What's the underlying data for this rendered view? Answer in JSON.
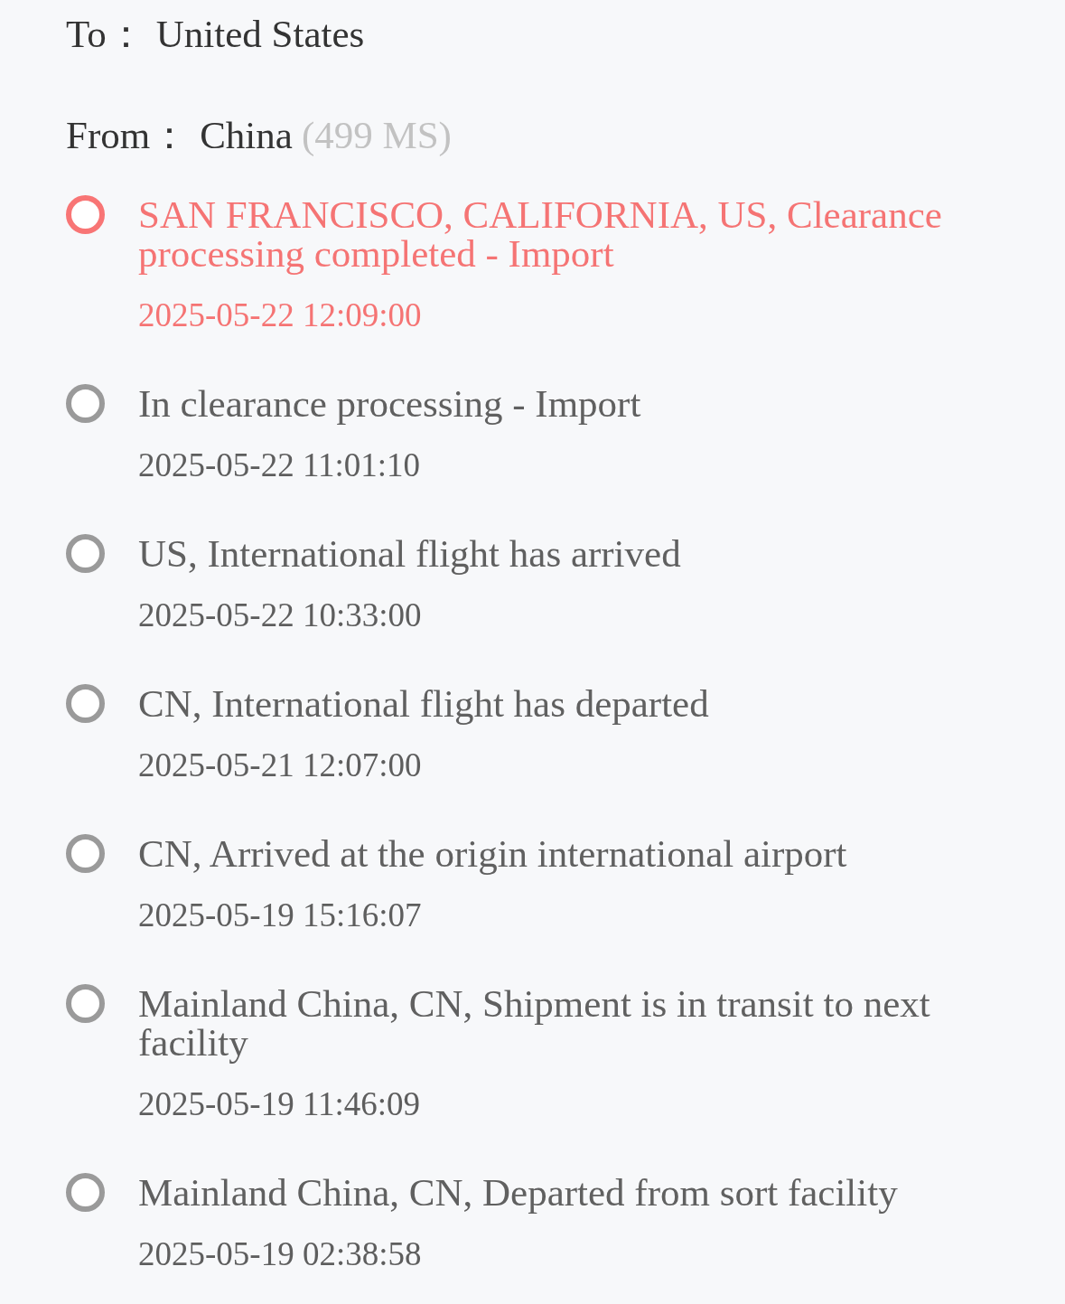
{
  "destination": {
    "label": "To：",
    "value": "United States"
  },
  "origin": {
    "label": "From：",
    "value": "China",
    "note": "(499 MS)"
  },
  "events": [
    {
      "description": "SAN FRANCISCO, CALIFORNIA, US, Clearance processing completed - Import",
      "time": "2025-05-22 12:09:00",
      "current": true
    },
    {
      "description": "In clearance processing - Import",
      "time": "2025-05-22 11:01:10",
      "current": false
    },
    {
      "description": "US, International flight has arrived",
      "time": "2025-05-22 10:33:00",
      "current": false
    },
    {
      "description": "CN, International flight has departed",
      "time": "2025-05-21 12:07:00",
      "current": false
    },
    {
      "description": "CN, Arrived at the origin international airport",
      "time": "2025-05-19 15:16:07",
      "current": false
    },
    {
      "description": "Mainland China, CN, Shipment is in transit to next facility",
      "time": "2025-05-19 11:46:09",
      "current": false
    },
    {
      "description": "Mainland China, CN, Departed from sort facility",
      "time": "2025-05-19 02:38:58",
      "current": false
    }
  ]
}
